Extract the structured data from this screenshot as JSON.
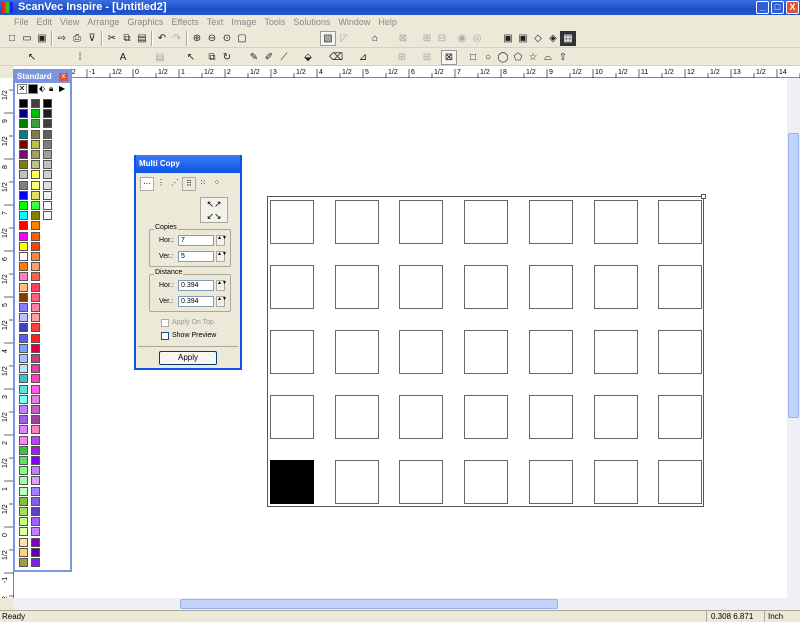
{
  "window": {
    "title": "ScanVec Inspire - [Untitled2]",
    "minimize": "_",
    "maximize": "□",
    "close": "X"
  },
  "menu": [
    "File",
    "Edit",
    "View",
    "Arrange",
    "Graphics",
    "Effects",
    "Text",
    "Image",
    "Tools",
    "Solutions",
    "Window",
    "Help"
  ],
  "toolbar1": [
    "new-icon",
    "open-icon",
    "save-icon",
    "print-icon",
    "cut-icon",
    "copy-icon",
    "paste-icon",
    "undo-icon",
    "redo-icon",
    "zoom-in-icon",
    "zoom-out-icon",
    "zoom-fit-icon"
  ],
  "ruler": {
    "h_labels": [
      "1/2",
      "-2",
      "1/2",
      "-1",
      "1/2",
      "0",
      "1/2",
      "1",
      "1/2",
      "2",
      "1/2",
      "3",
      "1/2",
      "4",
      "1/2",
      "5",
      "1/2",
      "6",
      "1/2",
      "7",
      "1/2",
      "8",
      "1/2",
      "9",
      "1/2",
      "10",
      "1/2",
      "11",
      "1/2",
      "12",
      "1/2",
      "13",
      "1/2",
      "14",
      "1/2"
    ],
    "v_labels": [
      "1/2",
      "9",
      "1/2",
      "8",
      "1/2",
      "7",
      "1/2",
      "6",
      "1/2",
      "5",
      "1/2",
      "4",
      "1/2",
      "3",
      "1/2",
      "2",
      "1/2",
      "1",
      "1/2",
      "0",
      "1/2",
      "-1",
      "1/2"
    ]
  },
  "palette": {
    "title": "Standard",
    "close": "x",
    "col1": [
      "#000000",
      "#000080",
      "#008000",
      "#008080",
      "#800000",
      "#800080",
      "#808000",
      "#c0c0c0",
      "#808080",
      "#0000ff",
      "#00ff00",
      "#00ffff",
      "#ff0000",
      "#ff00ff",
      "#ffff00",
      "#ffffff",
      "#ff8000",
      "#ff80c0",
      "#ffc080",
      "#804000",
      "#8080ff",
      "#c0c0ff",
      "#4040c0",
      "#6060e0",
      "#80a0ff",
      "#a0c0ff",
      "#c0e0ff",
      "#40c0c0",
      "#60e0e0",
      "#80ffff",
      "#c080ff",
      "#a060e0",
      "#e080ff",
      "#ff80ff",
      "#40c040",
      "#60e060",
      "#80ff80",
      "#a0ffa0",
      "#c0ffc0",
      "#80c040",
      "#a0e060",
      "#c0ff80",
      "#e0ffa0",
      "#ffe0a0",
      "#ffd080",
      "#a0a040"
    ],
    "col2": [
      "#404040",
      "#00c000",
      "#40a040",
      "#808040",
      "#c0c040",
      "#a0a060",
      "#c0c080",
      "#ffff40",
      "#ffff80",
      "#e0e060",
      "#40ff40",
      "#808000",
      "#ff8000",
      "#ff6000",
      "#ff4000",
      "#ff8040",
      "#ffa060",
      "#ff6040",
      "#ff4060",
      "#ff6080",
      "#ff80a0",
      "#ffa0a0",
      "#ff4040",
      "#ff2020",
      "#e00040",
      "#c04080",
      "#e040a0",
      "#ff40c0",
      "#ff60e0",
      "#e080e0",
      "#c060c0",
      "#a040a0",
      "#ff80c0",
      "#c040ff",
      "#a020e0",
      "#8000ff",
      "#c080ff",
      "#e0a0ff",
      "#a080ff",
      "#8060e0",
      "#6040c0",
      "#a060ff",
      "#c080ff",
      "#8000c0",
      "#6000a0",
      "#8020e0"
    ],
    "col3": [
      "#000000",
      "#202020",
      "#404040",
      "#606060",
      "#808080",
      "#a0a0a0",
      "#c0c0c0",
      "#d0d0d0",
      "#e0e0e0",
      "#f0f0f0",
      "#ffffff",
      "#f8f8f8"
    ]
  },
  "dialog": {
    "title": "Multi Copy",
    "copies_label": "Copies",
    "hor_label": "Hor.:",
    "ver_label": "Ver.:",
    "copies_hor": "7",
    "copies_ver": "5",
    "distance_label": "Distance",
    "dist_hor": "0.394",
    "dist_ver": "0.394",
    "apply_on_top": "Apply On Top",
    "show_preview": "Show Preview",
    "apply": "Apply"
  },
  "grid": {
    "cols": 7,
    "rows": 5,
    "filled": [
      4,
      0
    ]
  },
  "status": {
    "left": "Ready",
    "coords": "0.308  6.871",
    "unit": "Inch"
  }
}
